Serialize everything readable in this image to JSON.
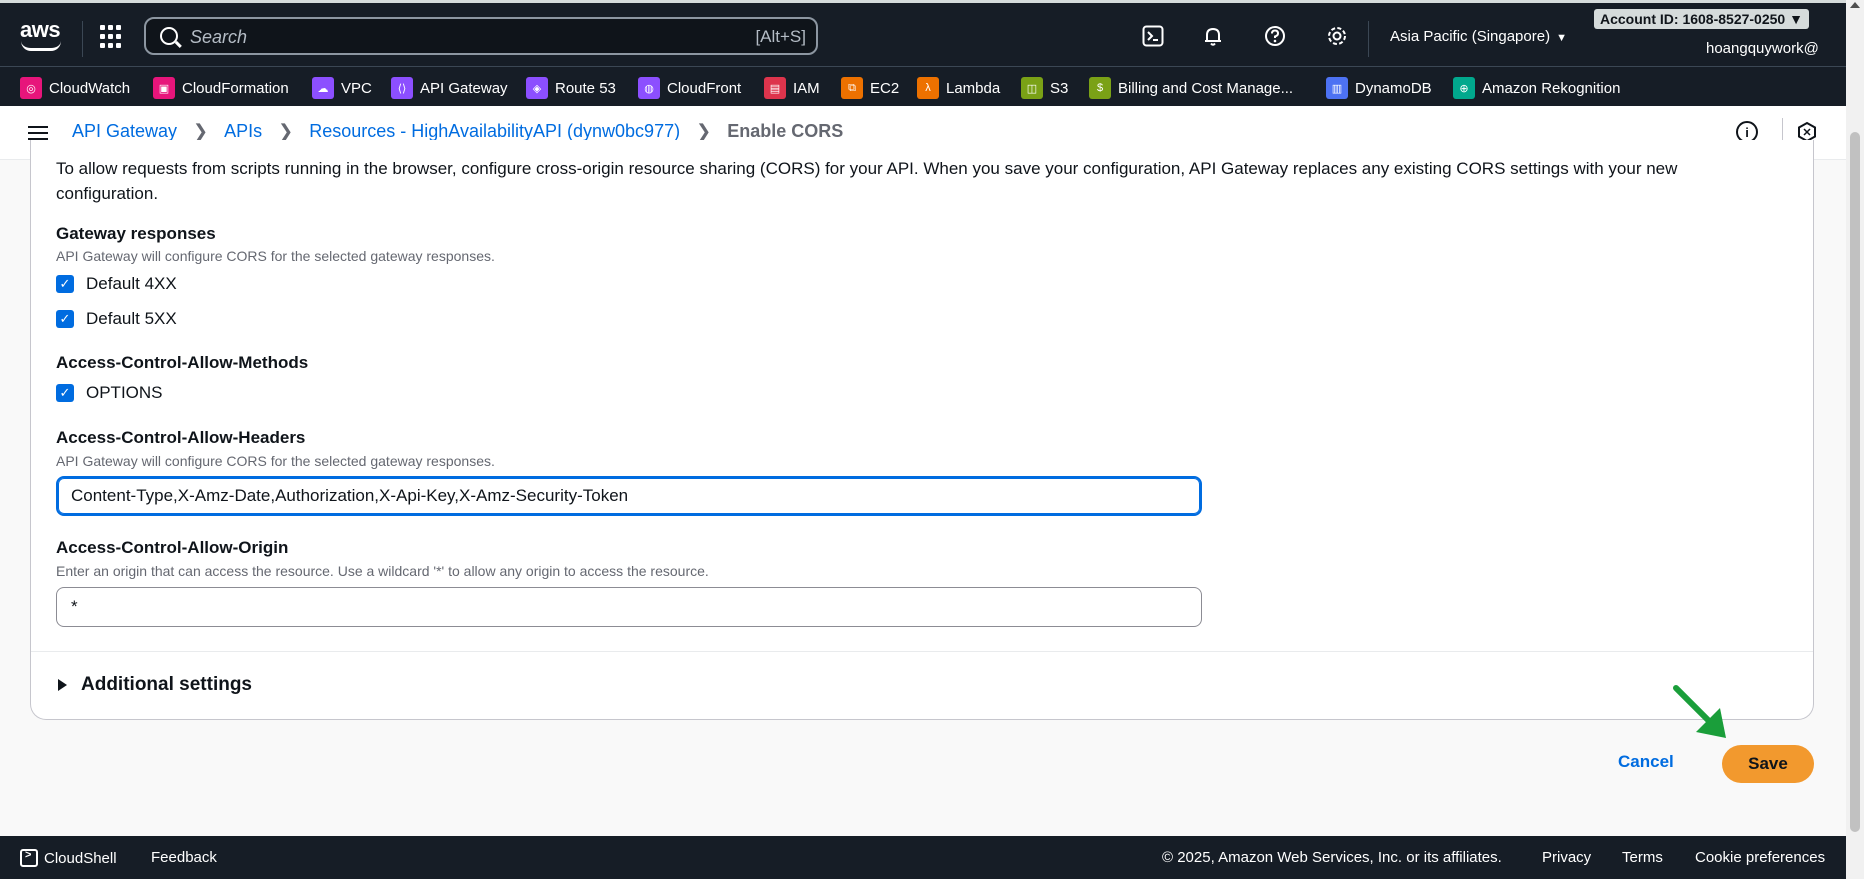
{
  "topnav": {
    "logo": "aws",
    "search_placeholder": "Search",
    "search_shortcut": "[Alt+S]",
    "region": "Asia Pacific (Singapore)",
    "account": "Account ID: 1608-8527-0250",
    "user": "hoangquywork@",
    "icons": [
      "cloudshell-icon",
      "bell-icon",
      "help-icon",
      "gear-icon"
    ]
  },
  "favorites": [
    {
      "label": "CloudWatch",
      "color": "#e7157b",
      "icon": "cloudwatch-icon"
    },
    {
      "label": "CloudFormation",
      "color": "#e7157b",
      "icon": "cloudformation-icon"
    },
    {
      "label": "VPC",
      "color": "#8c4fff",
      "icon": "vpc-icon"
    },
    {
      "label": "API Gateway",
      "color": "#8c4fff",
      "icon": "api-gateway-icon"
    },
    {
      "label": "Route 53",
      "color": "#8c4fff",
      "icon": "route53-icon"
    },
    {
      "label": "CloudFront",
      "color": "#8c4fff",
      "icon": "cloudfront-icon"
    },
    {
      "label": "IAM",
      "color": "#dd344c",
      "icon": "iam-icon"
    },
    {
      "label": "EC2",
      "color": "#ed7100",
      "icon": "ec2-icon"
    },
    {
      "label": "Lambda",
      "color": "#ed7100",
      "icon": "lambda-icon"
    },
    {
      "label": "S3",
      "color": "#7aa116",
      "icon": "s3-icon"
    },
    {
      "label": "Billing and Cost Manage...",
      "color": "#7aa116",
      "icon": "billing-icon"
    },
    {
      "label": "DynamoDB",
      "color": "#4d72f3",
      "icon": "dynamodb-icon"
    },
    {
      "label": "Amazon Rekognition",
      "color": "#01a88d",
      "icon": "rekognition-icon"
    }
  ],
  "breadcrumb": {
    "items": [
      "API Gateway",
      "APIs",
      "Resources - HighAvailabilityAPI (dynw0bc977)"
    ],
    "current": "Enable CORS"
  },
  "form": {
    "intro": "To allow requests from scripts running in the browser, configure cross-origin resource sharing (CORS) for your API. When you save your configuration, API Gateway replaces any existing CORS settings with your new configuration.",
    "gateway_responses": {
      "label": "Gateway responses",
      "desc": "API Gateway will configure CORS for the selected gateway responses.",
      "options": [
        "Default 4XX",
        "Default 5XX"
      ]
    },
    "allow_methods": {
      "label": "Access-Control-Allow-Methods",
      "options": [
        "OPTIONS"
      ]
    },
    "allow_headers": {
      "label": "Access-Control-Allow-Headers",
      "desc": "API Gateway will configure CORS for the selected gateway responses.",
      "value": "Content-Type,X-Amz-Date,Authorization,X-Api-Key,X-Amz-Security-Token"
    },
    "allow_origin": {
      "label": "Access-Control-Allow-Origin",
      "desc": "Enter an origin that can access the resource. Use a wildcard '*' to allow any origin to access the resource.",
      "value": "*"
    },
    "additional_settings": "Additional settings"
  },
  "actions": {
    "cancel": "Cancel",
    "save": "Save"
  },
  "footer": {
    "cloudshell": "CloudShell",
    "feedback": "Feedback",
    "copyright": "© 2025, Amazon Web Services, Inc. or its affiliates.",
    "privacy": "Privacy",
    "terms": "Terms",
    "cookies": "Cookie preferences"
  }
}
